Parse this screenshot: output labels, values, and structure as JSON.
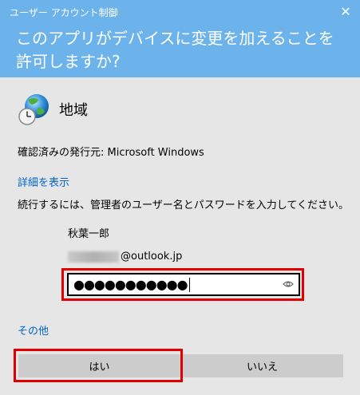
{
  "header": {
    "window_title": "ユーザー アカウント制御",
    "close_label": "✕",
    "question": "このアプリがデバイスに変更を加えることを許可しますか?"
  },
  "app": {
    "name": "地域",
    "icon": "globe-clock-icon",
    "publisher_text": "確認済みの発行元: Microsoft Windows"
  },
  "links": {
    "details": "詳細を表示",
    "more": "その他"
  },
  "credentials": {
    "instructions": "続行するには、管理者のユーザー名とパスワードを入力してください。",
    "username": "秋葉一郎",
    "email_hidden": "nao_user000",
    "email_domain": "@outlook.jp",
    "password_dots": "●●●●●●●●●●●",
    "reveal_icon": "eye-icon"
  },
  "buttons": {
    "yes": "はい",
    "no": "いいえ"
  },
  "colors": {
    "header_bg": "#6cb2eb",
    "dialog_bg": "#e6e6e6",
    "highlight": "#e00000",
    "link": "#0066cc"
  }
}
